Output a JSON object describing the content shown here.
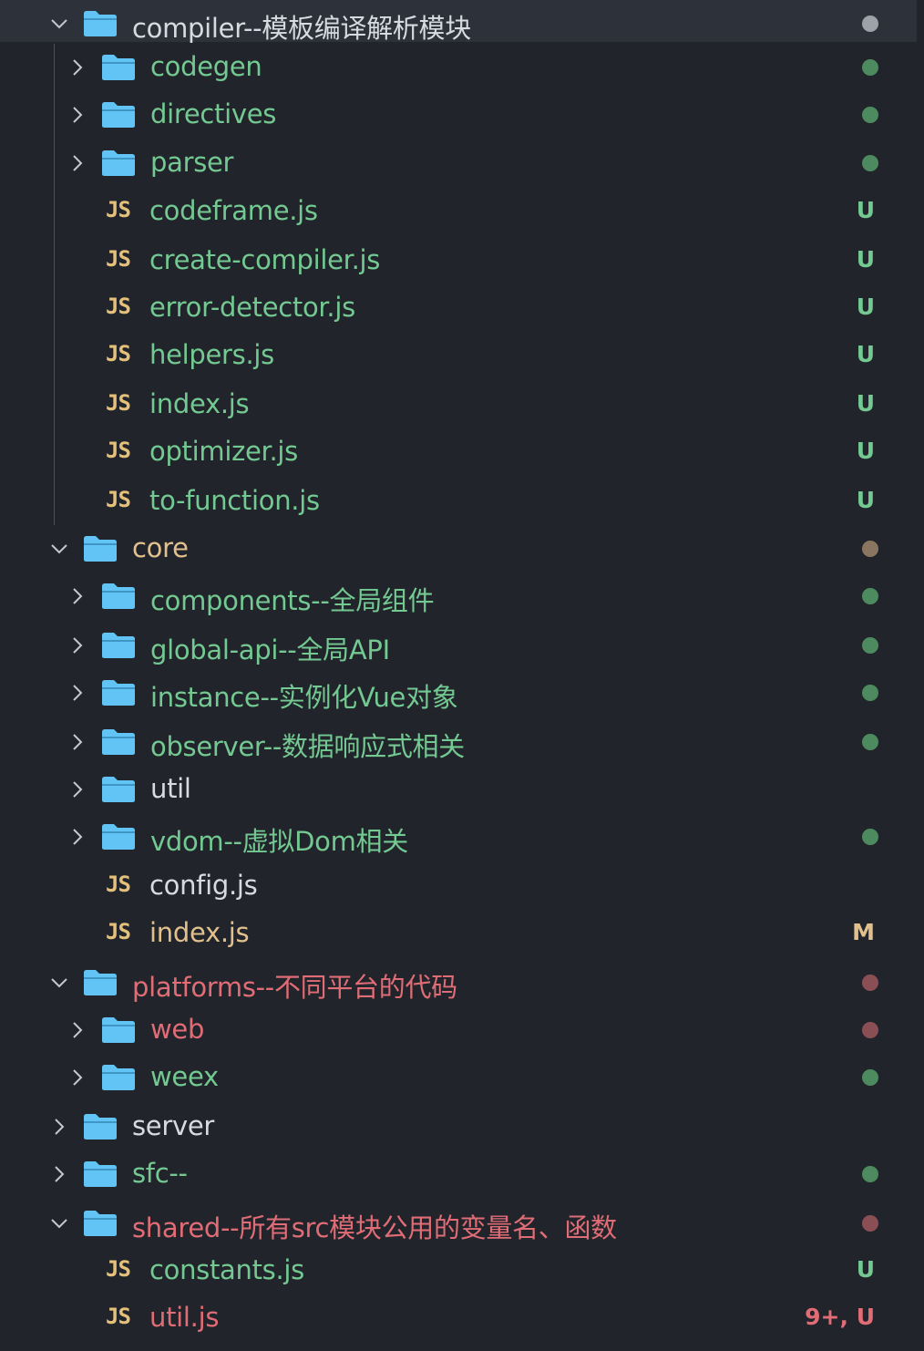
{
  "colors": {
    "bg": "#21252b",
    "selected_bg": "#2c313a",
    "default_text": "#d7dae0",
    "untracked": "#73c991",
    "modified": "#e2c08d",
    "deleted_like": "#e06c75",
    "ignored_dot": "#7f848e",
    "folder": "#62c4f5",
    "js": "#e5c07b"
  },
  "tree": [
    {
      "name": "compiler--模板编译解析模块",
      "type": "folder",
      "expanded": true,
      "depth": 0,
      "color": "default",
      "dot": "#9da1a8",
      "badge": "",
      "selected": true
    },
    {
      "name": "codegen",
      "type": "folder",
      "expanded": false,
      "depth": 1,
      "color": "untracked",
      "dot": "#4e8a5f",
      "badge": ""
    },
    {
      "name": "directives",
      "type": "folder",
      "expanded": false,
      "depth": 1,
      "color": "untracked",
      "dot": "#4e8a5f",
      "badge": ""
    },
    {
      "name": "parser",
      "type": "folder",
      "expanded": false,
      "depth": 1,
      "color": "untracked",
      "dot": "#4e8a5f",
      "badge": ""
    },
    {
      "name": "codeframe.js",
      "type": "file",
      "depth": 1,
      "color": "untracked",
      "dot": "",
      "badge": "U"
    },
    {
      "name": "create-compiler.js",
      "type": "file",
      "depth": 1,
      "color": "untracked",
      "dot": "",
      "badge": "U"
    },
    {
      "name": "error-detector.js",
      "type": "file",
      "depth": 1,
      "color": "untracked",
      "dot": "",
      "badge": "U"
    },
    {
      "name": "helpers.js",
      "type": "file",
      "depth": 1,
      "color": "untracked",
      "dot": "",
      "badge": "U"
    },
    {
      "name": "index.js",
      "type": "file",
      "depth": 1,
      "color": "untracked",
      "dot": "",
      "badge": "U"
    },
    {
      "name": "optimizer.js",
      "type": "file",
      "depth": 1,
      "color": "untracked",
      "dot": "",
      "badge": "U"
    },
    {
      "name": "to-function.js",
      "type": "file",
      "depth": 1,
      "color": "untracked",
      "dot": "",
      "badge": "U"
    },
    {
      "name": "core",
      "type": "folder",
      "expanded": true,
      "depth": 0,
      "color": "modified",
      "dot": "#8a7660",
      "badge": ""
    },
    {
      "name": "components--全局组件",
      "type": "folder",
      "expanded": false,
      "depth": 1,
      "color": "untracked",
      "dot": "#4e8a5f",
      "badge": ""
    },
    {
      "name": "global-api--全局API",
      "type": "folder",
      "expanded": false,
      "depth": 1,
      "color": "untracked",
      "dot": "#4e8a5f",
      "badge": ""
    },
    {
      "name": "instance--实例化Vue对象",
      "type": "folder",
      "expanded": false,
      "depth": 1,
      "color": "untracked",
      "dot": "#4e8a5f",
      "badge": ""
    },
    {
      "name": "observer--数据响应式相关",
      "type": "folder",
      "expanded": false,
      "depth": 1,
      "color": "untracked",
      "dot": "#4e8a5f",
      "badge": ""
    },
    {
      "name": "util",
      "type": "folder",
      "expanded": false,
      "depth": 1,
      "color": "default",
      "dot": "",
      "badge": ""
    },
    {
      "name": "vdom--虚拟Dom相关",
      "type": "folder",
      "expanded": false,
      "depth": 1,
      "color": "untracked",
      "dot": "#4e8a5f",
      "badge": ""
    },
    {
      "name": "config.js",
      "type": "file",
      "depth": 1,
      "color": "default",
      "dot": "",
      "badge": ""
    },
    {
      "name": "index.js",
      "type": "file",
      "depth": 1,
      "color": "modified",
      "dot": "",
      "badge": "M"
    },
    {
      "name": "platforms--不同平台的代码",
      "type": "folder",
      "expanded": true,
      "depth": 0,
      "color": "deleted_like",
      "dot": "#8a4f54",
      "badge": ""
    },
    {
      "name": "web",
      "type": "folder",
      "expanded": false,
      "depth": 1,
      "color": "deleted_like",
      "dot": "#8a4f54",
      "badge": ""
    },
    {
      "name": "weex",
      "type": "folder",
      "expanded": false,
      "depth": 1,
      "color": "untracked",
      "dot": "#4e8a5f",
      "badge": ""
    },
    {
      "name": "server",
      "type": "folder",
      "expanded": false,
      "depth": 0,
      "color": "default",
      "dot": "",
      "badge": ""
    },
    {
      "name": "sfc--",
      "type": "folder",
      "expanded": false,
      "depth": 0,
      "color": "untracked",
      "dot": "#4e8a5f",
      "badge": ""
    },
    {
      "name": "shared--所有src模块公用的变量名、函数",
      "type": "folder",
      "expanded": true,
      "depth": 0,
      "color": "deleted_like",
      "dot": "#8a4f54",
      "badge": ""
    },
    {
      "name": "constants.js",
      "type": "file",
      "depth": 1,
      "color": "untracked",
      "dot": "",
      "badge": "U"
    },
    {
      "name": "util.js",
      "type": "file",
      "depth": 1,
      "color": "deleted_like",
      "dot": "",
      "badge": "9+, U",
      "badge_color": "deleted_like"
    }
  ],
  "js_label": "JS"
}
